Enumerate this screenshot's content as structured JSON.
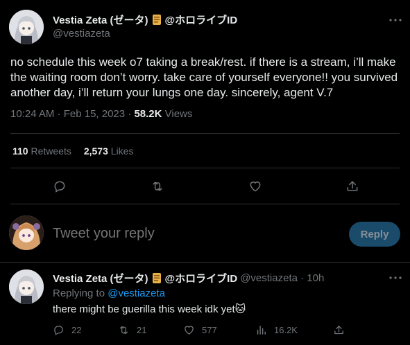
{
  "colors": {
    "background": "#000000",
    "text": "#e7e9ea",
    "muted": "#71767b",
    "link": "#1d9bf0",
    "divider": "#2f3336",
    "reply_button_bg": "#1a4b6b"
  },
  "main_tweet": {
    "display_name": "Vestia Zeta (ゼータ)",
    "badge_icon": "scroll-icon",
    "affiliation": "@ホロライブID",
    "handle": "@vestiazeta",
    "text": "no schedule this week o7 taking a break/rest. if there is a stream, i’ll make the waiting room don’t worry. take care of yourself everyone!! you survived another day, i’ll return your lungs one day. sincerely, agent V.7",
    "time": "10:24 AM · Feb 15, 2023 · ",
    "views_count": "58.2K",
    "views_label": " Views",
    "retweets_count": "110",
    "retweets_label": " Retweets",
    "likes_count": "2,573",
    "likes_label": " Likes",
    "actions": [
      "reply-icon",
      "retweet-icon",
      "like-icon",
      "share-icon"
    ]
  },
  "reply_composer": {
    "placeholder": "Tweet your reply",
    "button_label": "Reply"
  },
  "reply_tweet": {
    "display_name": "Vestia Zeta (ゼータ)",
    "affiliation": "@ホロライブID",
    "handle_time": "@vestiazeta · 10h",
    "replying_to_label": "Replying to ",
    "replying_to_handle": "@vestiazeta",
    "text": "there might be guerilla this week idk yet🐱",
    "replies": "22",
    "retweets": "21",
    "likes": "577",
    "views": "16.2K"
  }
}
